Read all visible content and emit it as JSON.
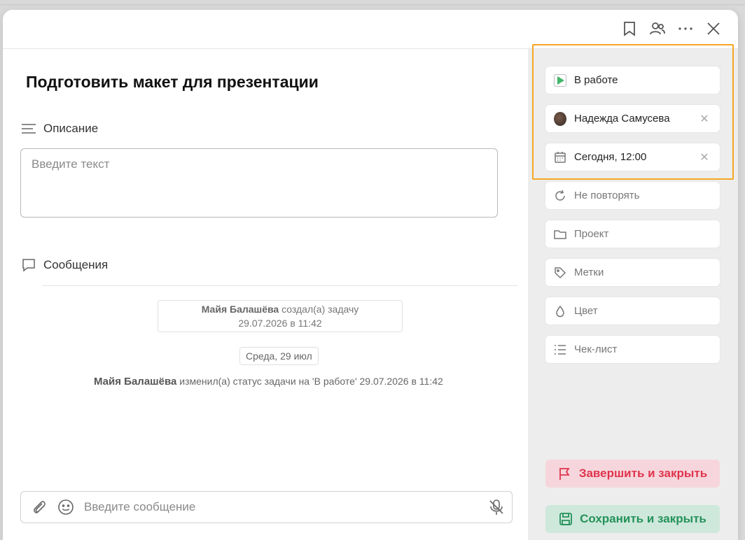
{
  "task": {
    "title": "Подготовить макет для презентации"
  },
  "description": {
    "label": "Описание",
    "placeholder": "Введите текст"
  },
  "messages": {
    "label": "Сообщения",
    "created": {
      "author": "Майя Балашёва",
      "action": "создал(а) задачу",
      "datetime": "29.07.2026 в 11:42"
    },
    "date_chip": "Среда, 29 июл",
    "status_log": {
      "author": "Майя Балашёва",
      "text": "изменил(а) статус задачи на 'В работе' 29.07.2026 в 11:42"
    }
  },
  "composer": {
    "placeholder": "Введите сообщение"
  },
  "sidebar": {
    "status": "В работе",
    "assignee": "Надежда Самусева",
    "due": "Сегодня, 12:00",
    "repeat": "Не повторять",
    "project": "Проект",
    "tags": "Метки",
    "color": "Цвет",
    "checklist": "Чек-лист",
    "finish_button": "Завершить и закрыть",
    "save_button": "Сохранить и закрыть"
  },
  "colors": {
    "highlight": "#f5a623",
    "finish": "#e0344d",
    "save": "#24925a",
    "status_play": "#43b66a"
  }
}
